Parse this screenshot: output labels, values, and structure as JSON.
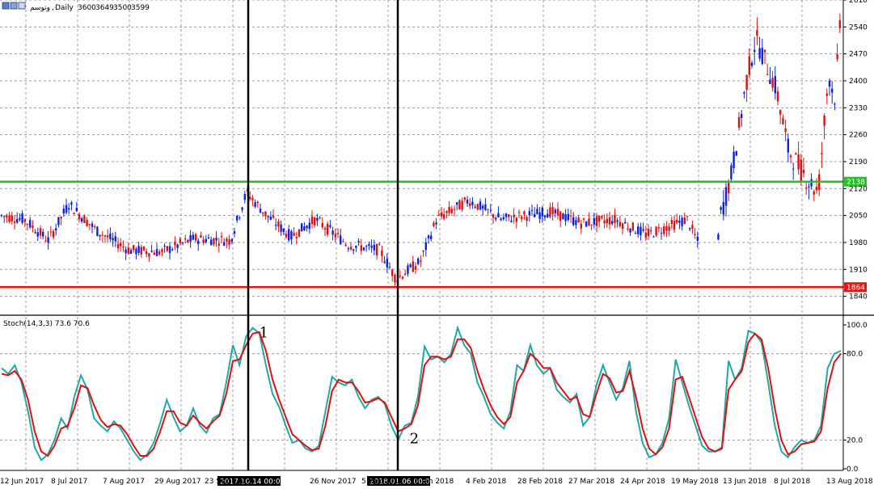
{
  "chart_data": [
    {
      "type": "candlestick",
      "header": {
        "symbol": "وتوسم",
        "period": "Daily",
        "ohlc": [
          "3600",
          "3649",
          "3500",
          "3599"
        ]
      },
      "ylim": [
        1793,
        2610
      ],
      "y_ticks": [
        1840,
        1910,
        1980,
        2050,
        2120,
        2190,
        2260,
        2330,
        2400,
        2470,
        2540,
        2610
      ],
      "x_tick_labels": [
        "12 Jun 2017",
        "8 Jul 2017",
        "7 Aug 2017",
        "29 Aug 2017",
        "23 Sep 2017",
        "26 Nov 2017",
        "5 Dec 2017",
        "5 Jan 2018",
        "4 Feb 2018",
        "28 Feb 2018",
        "27 Mar 2018",
        "24 Apr 2018",
        "19 May 2018",
        "13 Jun 2018",
        "8 Jul 2018",
        "13 Aug 2018"
      ],
      "horizontal_lines": [
        {
          "value": 2138,
          "label": "2138",
          "color": "#22c322"
        },
        {
          "value": 1864,
          "label": "1864",
          "color": "#ee1111"
        }
      ],
      "vertical_markers": [
        {
          "label": "2017.10.14 00:00",
          "number": "1"
        },
        {
          "label": "2018.01.06 00:00",
          "number": "2"
        }
      ],
      "colors": {
        "bull": "#0b22e0",
        "bear": "#e01010",
        "grid": "#9a9a9a"
      }
    },
    {
      "type": "line",
      "title": "Stoch(14,3,3) 73.6 70.6",
      "ylim": [
        0,
        100
      ],
      "y_ticks": [
        "0.0",
        "20.0",
        "80.0",
        "100.0"
      ],
      "series": [
        {
          "color": "#20a8a8",
          "values": [
            70,
            66,
            72,
            60,
            40,
            15,
            6,
            10,
            20,
            35,
            28,
            50,
            65,
            55,
            35,
            30,
            26,
            33,
            28,
            20,
            12,
            6,
            10,
            18,
            32,
            48,
            36,
            26,
            30,
            42,
            30,
            25,
            35,
            38,
            60,
            86,
            72,
            92,
            98,
            94,
            72,
            52,
            43,
            30,
            18,
            20,
            14,
            12,
            16,
            40,
            64,
            60,
            58,
            62,
            50,
            42,
            48,
            50,
            45,
            30,
            20,
            30,
            32,
            50,
            85,
            76,
            78,
            74,
            80,
            98,
            86,
            80,
            60,
            50,
            38,
            32,
            28,
            40,
            72,
            68,
            86,
            72,
            66,
            70,
            55,
            50,
            46,
            52,
            30,
            36,
            58,
            72,
            60,
            48,
            56,
            75,
            40,
            18,
            8,
            10,
            18,
            35,
            76,
            60,
            44,
            30,
            16,
            12,
            12,
            15,
            75,
            62,
            70,
            96,
            94,
            88,
            60,
            30,
            12,
            8,
            15,
            20,
            18,
            20,
            30,
            70,
            80,
            82
          ]
        },
        {
          "color": "#e01010",
          "values": [
            66,
            65,
            68,
            62,
            48,
            26,
            12,
            9,
            16,
            28,
            30,
            42,
            58,
            56,
            44,
            34,
            29,
            31,
            30,
            24,
            16,
            9,
            9,
            14,
            26,
            40,
            40,
            32,
            30,
            37,
            32,
            28,
            33,
            37,
            52,
            75,
            76,
            86,
            94,
            95,
            82,
            62,
            48,
            36,
            24,
            20,
            16,
            13,
            14,
            30,
            54,
            62,
            60,
            60,
            54,
            46,
            47,
            49,
            46,
            36,
            26,
            28,
            31,
            44,
            72,
            78,
            78,
            76,
            78,
            90,
            90,
            84,
            68,
            55,
            44,
            36,
            31,
            36,
            60,
            68,
            80,
            76,
            70,
            70,
            60,
            54,
            48,
            50,
            38,
            36,
            52,
            66,
            63,
            53,
            54,
            68,
            50,
            28,
            14,
            10,
            15,
            28,
            62,
            64,
            50,
            36,
            22,
            14,
            12,
            14,
            55,
            62,
            68,
            88,
            94,
            90,
            70,
            42,
            20,
            10,
            12,
            17,
            18,
            19,
            26,
            56,
            74,
            80
          ]
        }
      ],
      "markers": [
        {
          "label": "1",
          "at": 38
        },
        {
          "label": "2",
          "at": 61
        }
      ]
    }
  ]
}
